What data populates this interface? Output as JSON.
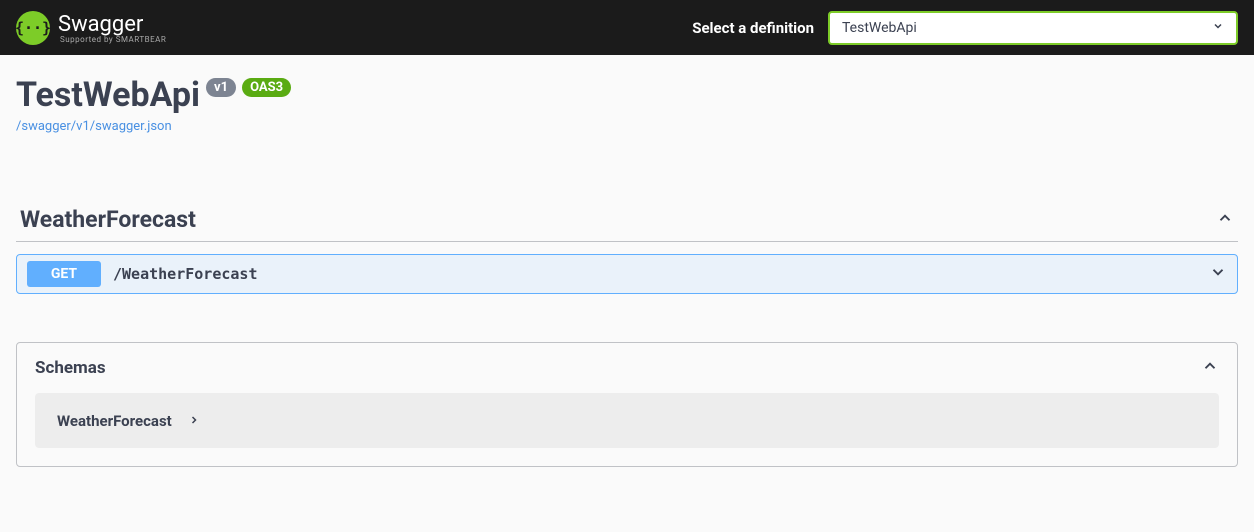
{
  "topbar": {
    "logo_text": "Swagger",
    "logo_sub": "Supported by SMARTBEAR",
    "definition_label": "Select a definition",
    "selected_definition": "TestWebApi"
  },
  "info": {
    "title": "TestWebApi",
    "version_badge": "v1",
    "oas_badge": "OAS3",
    "spec_url": "/swagger/v1/swagger.json"
  },
  "tags": [
    {
      "name": "WeatherForecast",
      "operations": [
        {
          "method": "GET",
          "path": "/WeatherForecast"
        }
      ]
    }
  ],
  "schemas": {
    "title": "Schemas",
    "items": [
      {
        "name": "WeatherForecast"
      }
    ]
  },
  "colors": {
    "brand_green": "#7dcc28",
    "get_blue": "#61affe",
    "text_dark": "#3b4151",
    "link_blue": "#4990e2"
  }
}
